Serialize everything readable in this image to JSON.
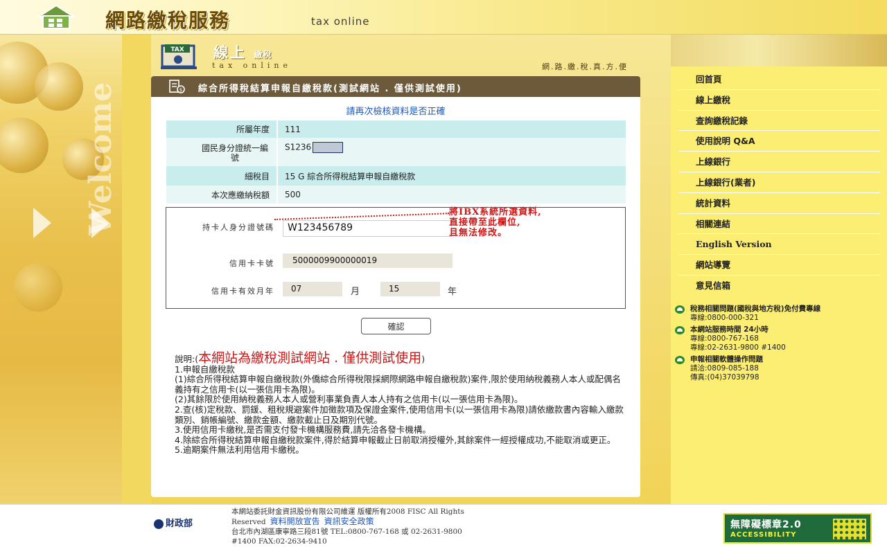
{
  "header": {
    "title": "網路繳稅服務",
    "subtitle": "tax online"
  },
  "banner": {
    "title": "線上",
    "title_small": "繳稅",
    "subtitle": "tax online",
    "tagline": "網.路.繳.稅.真.方.便"
  },
  "panel": {
    "title": "綜合所得稅結算申報自繳稅款(測試網站 . 僅供測試使用)",
    "confirm_message": "請再次檢核資料是否正確",
    "rows": [
      {
        "label": "所屬年度",
        "value": "111"
      },
      {
        "label": "國民身分證統一編號",
        "value": "S1236"
      },
      {
        "label": "細稅目",
        "value": "15 G 綜合所得稅結算申報自繳稅款"
      },
      {
        "label": "本次應繳納稅額",
        "value": "500"
      }
    ],
    "card": {
      "id_label": "持卡人身分證號碼",
      "id_value": "W123456789",
      "number_label": "信用卡卡號",
      "number_value": "5000009900000019",
      "expiry_label": "信用卡有效月年",
      "expiry_month": "07",
      "month_unit": "月",
      "expiry_year": "15",
      "year_unit": "年"
    },
    "annotation": {
      "line1": "將IBX系統所選資料,",
      "line2": "直接帶至此欄位,",
      "line3": "且無法修改。"
    },
    "confirm_button": "確認"
  },
  "notes": {
    "prefix": "說明:(",
    "highlight": "本網站為繳稅測試網站 . 僅供測試使用",
    "suffix": ")",
    "items": [
      "1.申報自繳稅款",
      "(1)綜合所得稅結算申報自繳稅款(外僑綜合所得稅限採網際網路申報自繳稅款)案件,限於使用納稅義務人本人或配偶名義持有之信用卡(以一張信用卡為限)。",
      "(2)其餘限於使用納稅義務人本人或營利事業負責人本人持有之信用卡(以一張信用卡為限)。",
      "2.查(核)定稅款、罰鍰、租稅規避案件加徵款項及保證金案件,使用信用卡(以一張信用卡為限)請依繳款書內容輸入繳款類別、銷帳編號、繳款金額、繳款截止日及期別代號。",
      "3.使用信用卡繳稅,是否需支付發卡機構服務費,請先洽各發卡機構。",
      "4.除綜合所得稅結算申報自繳稅款案件,得於結算申報截止日前取消授權外,其餘案件一經授權成功,不能取消或更正。",
      "5.逾期案件無法利用信用卡繳稅。"
    ]
  },
  "sidebar": {
    "items": [
      {
        "label": "回首頁"
      },
      {
        "label": "線上繳稅"
      },
      {
        "label": "查詢繳稅記錄"
      },
      {
        "label": "使用說明 Q&A"
      },
      {
        "label": "上線銀行"
      },
      {
        "label": "上線銀行(業者)"
      },
      {
        "label": "統計資料"
      },
      {
        "label": "相關連結"
      },
      {
        "label": "English Version"
      },
      {
        "label": "網站導覽"
      },
      {
        "label": "意見信箱"
      }
    ],
    "contacts": [
      {
        "title": "稅務相關問題(國稅與地方稅)免付費專線",
        "lines": [
          "專線:0800-000-321"
        ]
      },
      {
        "title": "本網站服務時間 24小時",
        "lines": [
          "專線:0800-767-168",
          "專線:02-2631-9800 #1400"
        ]
      },
      {
        "title": "申報相關軟體操作問題",
        "lines": [
          "請洽:0809-085-188",
          "傳真:(04)37039798"
        ]
      }
    ]
  },
  "footer": {
    "logo_text": "財政部",
    "line1": "本網站委託財金資訊股份有限公司維運 版權所有2008 FISC All Rights",
    "line2_prefix": "Reserved",
    "link1": "資料開放宣告",
    "link2": "資訊安全政策",
    "line3": "台北市內湖區康寧路三段81號 TEL:0800-767-168 或 02-2631-9800",
    "line4": "#1400 FAX:02-2634-9410",
    "badge_line1": "無障礙標章2.0",
    "badge_line2": "ACCESSIBILITY"
  },
  "colors": {
    "panel_header": "#6c5a3b",
    "table_row": "#c9ecec",
    "annotation": "#d01515",
    "link": "#1e57b8",
    "sidebar": "#fbee72"
  }
}
